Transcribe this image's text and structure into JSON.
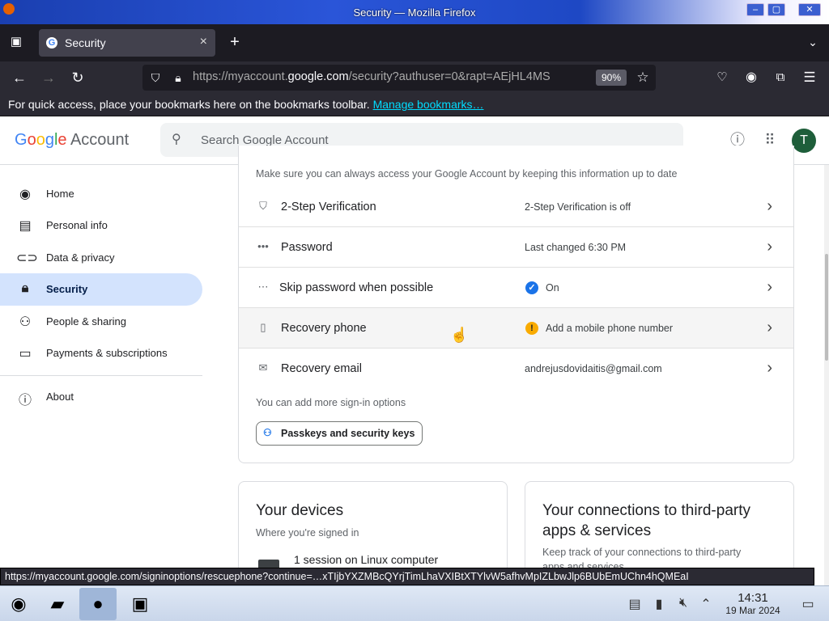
{
  "window": {
    "title": "Security — Mozilla Firefox",
    "min": "–",
    "max": "▢",
    "close": "✕"
  },
  "tabs": [
    {
      "label": "Security",
      "close": "×"
    }
  ],
  "new_tab": "+",
  "toolbar": {
    "url_prefix": "https://myaccount.",
    "url_domain": "google.com",
    "url_rest": "/security?authuser=0&rapt=AEjHL4MS",
    "zoom": "90%"
  },
  "bookmarks_bar": {
    "text": "For quick access, place your bookmarks here on the bookmarks toolbar.",
    "link": "Manage bookmarks…"
  },
  "header": {
    "logo_g": "Google",
    "logo_account": "Account",
    "search_placeholder": "Search Google Account",
    "avatar": "T"
  },
  "sidebar": {
    "items": [
      {
        "label": "Home",
        "icon": "home-icon"
      },
      {
        "label": "Personal info",
        "icon": "id-card-icon"
      },
      {
        "label": "Data & privacy",
        "icon": "toggle-icon"
      },
      {
        "label": "Security",
        "icon": "lock-icon",
        "active": true
      },
      {
        "label": "People & sharing",
        "icon": "people-icon"
      },
      {
        "label": "Payments & subscriptions",
        "icon": "card-icon"
      },
      {
        "label": "About",
        "icon": "info-icon"
      }
    ]
  },
  "signin": {
    "intro": "Make sure you can always access your Google Account by keeping this information up to date",
    "rows": [
      {
        "label": "2-Step Verification",
        "value": "2-Step Verification is off"
      },
      {
        "label": "Password",
        "value": "Last changed 6:30 PM"
      },
      {
        "label": "Skip password when possible",
        "value": "On"
      },
      {
        "label": "Recovery phone",
        "value": "Add a mobile phone number"
      },
      {
        "label": "Recovery email",
        "value": "andrejusdovidaitis@gmail.com"
      }
    ],
    "more": "You can add more sign-in options",
    "passkeys_button": "Passkeys and security keys"
  },
  "devices": {
    "title": "Your devices",
    "subtitle": "Where you're signed in",
    "session": "1 session on Linux computer"
  },
  "connections": {
    "title_line1": "Your connections to third-party",
    "title_line2": "apps & services",
    "subtitle_line1": "Keep track of your connections to third-party",
    "subtitle_line2": "apps and services"
  },
  "status_url": "https://myaccount.google.com/signinoptions/rescuephone?continue=…xTIjbYXZMBcQYrjTimLhaVXIBtXTYlvW5afhvMpIZLbwJlp6BUbEmUChn4hQMEaI",
  "taskbar": {
    "time": "14:31",
    "date": "19 Mar 2024"
  },
  "colors": {
    "accent": "#1a73e8",
    "active_nav": "#d3e3fd",
    "warning": "#f9ab00",
    "check": "#1a73e8"
  }
}
